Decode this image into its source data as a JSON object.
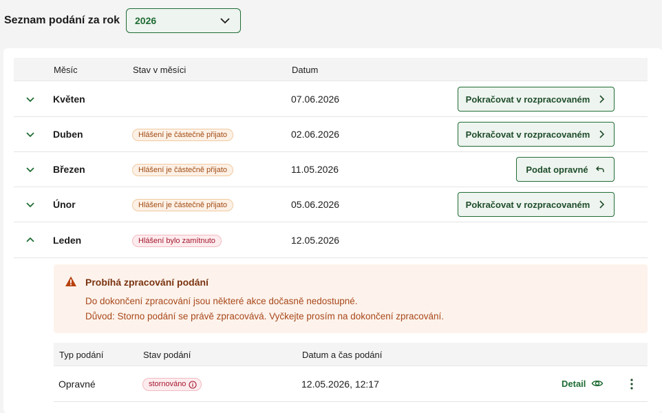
{
  "header": {
    "title": "Seznam podání za rok",
    "year_select": {
      "value": "2026",
      "icon": "chevron-down-icon"
    }
  },
  "table": {
    "columns": [
      "Měsíc",
      "Stav v měsíci",
      "Datum"
    ],
    "rows": [
      {
        "month": "Květen",
        "status": "",
        "date": "07.06.2026",
        "action": "Pokračovat v rozpracovaném",
        "expanded": false
      },
      {
        "month": "Duben",
        "status": "Hlášení je částečně přijato",
        "date": "02.06.2026",
        "action": "Pokračovat v rozpracovaném",
        "expanded": false
      },
      {
        "month": "Březen",
        "status": "Hlášení je částečně přijato",
        "date": "11.05.2026",
        "action": "Podat opravné",
        "expanded": false
      },
      {
        "month": "Únor",
        "status": "Hlášení je částečně přijato",
        "date": "05.06.2026",
        "action": "Pokračovat v rozpracovaném",
        "expanded": false
      },
      {
        "month": "Leden",
        "status": "Hlášení bylo zamítnuto",
        "date": "12.05.2026",
        "action": "",
        "expanded": true
      }
    ]
  },
  "alert": {
    "title": "Probíhá zpracování podání",
    "line1": "Do dokončení zpracování jsou některé akce dočasně nedostupné.",
    "line2": "Důvod: Storno podání se právě zpracovává. Vyčkejte prosím na dokončení zpracování.",
    "icon": "warning-icon"
  },
  "subtable": {
    "columns": [
      "Typ podání",
      "Stav podání",
      "Datum a čas podání"
    ],
    "rows": [
      {
        "type": "Opravné",
        "status": "stornováno",
        "datetime": "12.05.2026, 12:17",
        "detail_label": "Detail"
      }
    ]
  },
  "colors": {
    "accent": "#1e6b33",
    "warning_bg": "#fdf3ec",
    "error": "#a3162e",
    "warn": "#a04a12"
  }
}
